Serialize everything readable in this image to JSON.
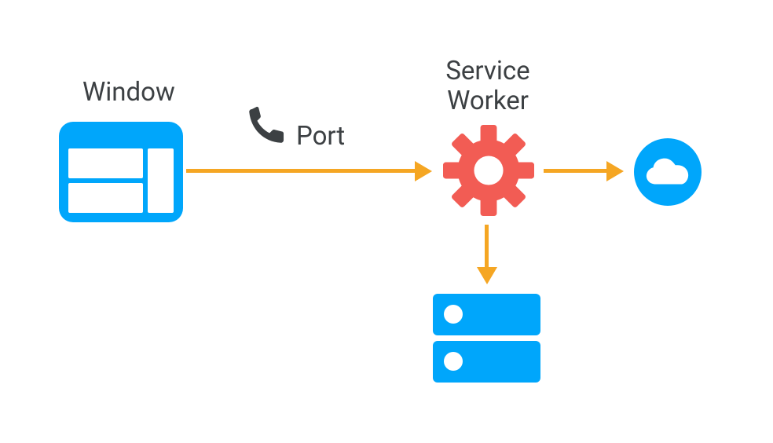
{
  "labels": {
    "window": "Window",
    "port": "Port",
    "service_worker_line1": "Service",
    "service_worker_line2": "Worker"
  },
  "icons": {
    "window": "window-icon",
    "phone": "phone-icon",
    "gear": "gear-icon",
    "cloud": "cloud-icon",
    "cache": "cache-icon"
  },
  "colors": {
    "blue": "#00a6fb",
    "red": "#f25c54",
    "orange": "#f5a623",
    "dark": "#3c4043",
    "white": "#ffffff"
  },
  "arrows": [
    {
      "from": "window",
      "to": "service-worker",
      "direction": "right"
    },
    {
      "from": "service-worker",
      "to": "cloud",
      "direction": "right"
    },
    {
      "from": "service-worker",
      "to": "cache",
      "direction": "down"
    }
  ]
}
